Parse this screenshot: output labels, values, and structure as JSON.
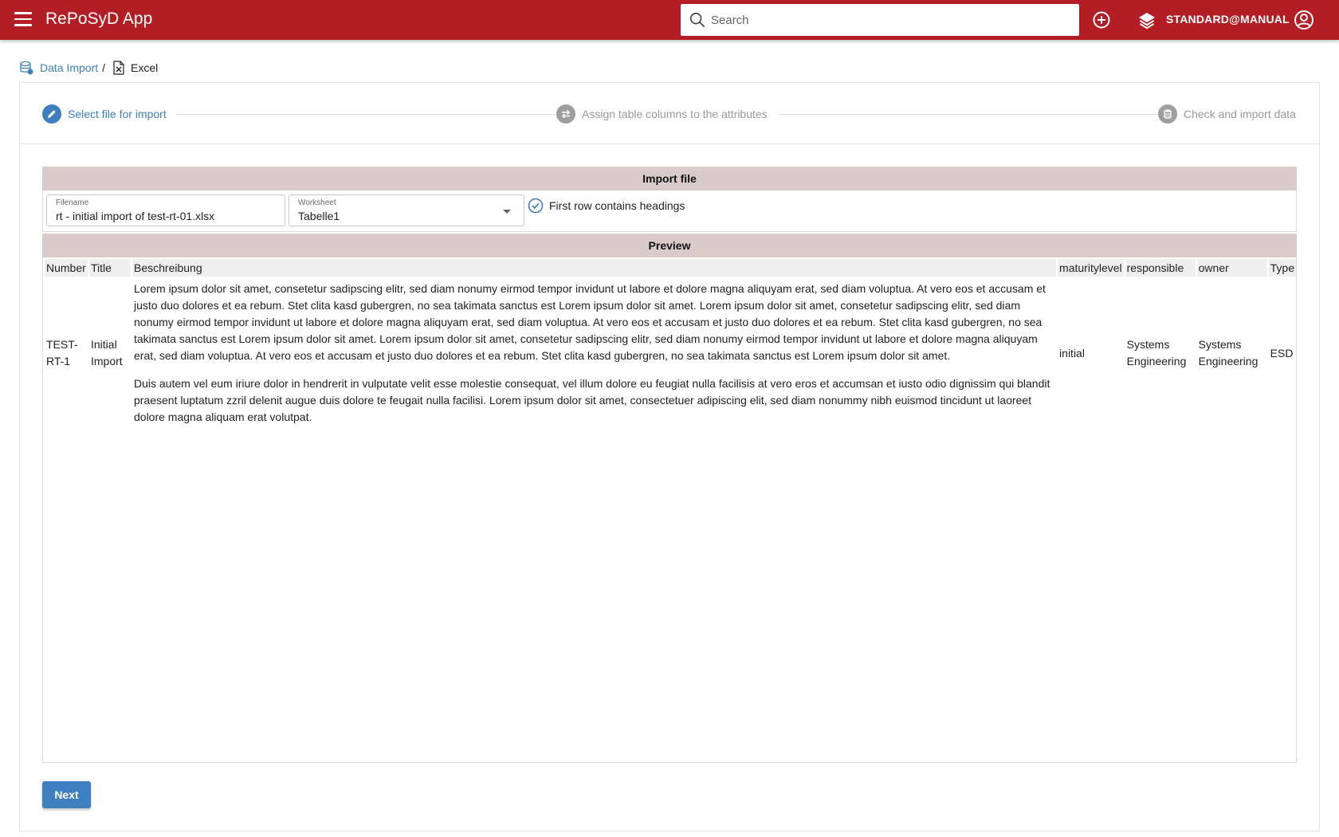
{
  "header": {
    "app_title": "RePoSyD App",
    "search_placeholder": "Search",
    "profile": "STANDARD@MANUAL",
    "bar_color": "#b31e25"
  },
  "breadcrumb": {
    "parent": "Data Import",
    "separator": "/",
    "current": "Excel"
  },
  "stepper": {
    "steps": [
      {
        "label": "Select file for import",
        "state": "active",
        "icon": "pencil-icon"
      },
      {
        "label": "Assign table columns to the attributes",
        "state": "inactive",
        "icon": "swap-icon"
      },
      {
        "label": "Check and import data",
        "state": "inactive",
        "icon": "database-icon"
      }
    ]
  },
  "import_file": {
    "title": "Import file",
    "filename_label": "Filename",
    "filename_value": "rt - initial import of test-rt-01.xlsx",
    "worksheet_label": "Worksheet",
    "worksheet_value": "Tabelle1",
    "first_row_headings_label": "First row contains headings",
    "first_row_headings_checked": true
  },
  "preview": {
    "title": "Preview",
    "columns": [
      "Number",
      "Title",
      "Beschreibung",
      "maturitylevel",
      "responsible",
      "owner",
      "Type"
    ],
    "rows": [
      {
        "number": "TEST-RT-1",
        "title": "Initial Import",
        "beschreibung_p1": "Lorem ipsum dolor sit amet, consetetur sadipscing elitr, sed diam nonumy eirmod tempor invidunt ut labore et dolore magna aliquyam erat, sed diam voluptua. At vero eos et accusam et justo duo dolores et ea rebum. Stet clita kasd gubergren, no sea takimata sanctus est Lorem ipsum dolor sit amet. Lorem ipsum dolor sit amet, consetetur sadipscing elitr, sed diam nonumy eirmod tempor invidunt ut labore et dolore magna aliquyam erat, sed diam voluptua. At vero eos et accusam et justo duo dolores et ea rebum. Stet clita kasd gubergren, no sea takimata sanctus est Lorem ipsum dolor sit amet. Lorem ipsum dolor sit amet, consetetur sadipscing elitr, sed diam nonumy eirmod tempor invidunt ut labore et dolore magna aliquyam erat, sed diam voluptua. At vero eos et accusam et justo duo dolores et ea rebum. Stet clita kasd gubergren, no sea takimata sanctus est Lorem ipsum dolor sit amet.",
        "beschreibung_p2": "Duis autem vel eum iriure dolor in hendrerit in vulputate velit esse molestie consequat, vel illum dolore eu feugiat nulla facilisis at vero eros et accumsan et iusto odio dignissim qui blandit praesent luptatum zzril delenit augue duis dolore te feugait nulla facilisi. Lorem ipsum dolor sit amet, consectetuer adipiscing elit, sed diam nonummy nibh euismod tincidunt ut laoreet dolore magna aliquam erat volutpat.",
        "maturitylevel": "initial",
        "responsible": "Systems Engineering",
        "owner": "Systems Engineering",
        "type": "ESD"
      }
    ]
  },
  "actions": {
    "next_label": "Next"
  },
  "colors": {
    "accent": "#3e7fbf",
    "section_header": "#d8cbc9",
    "inactive_step": "#9e9e9e"
  }
}
